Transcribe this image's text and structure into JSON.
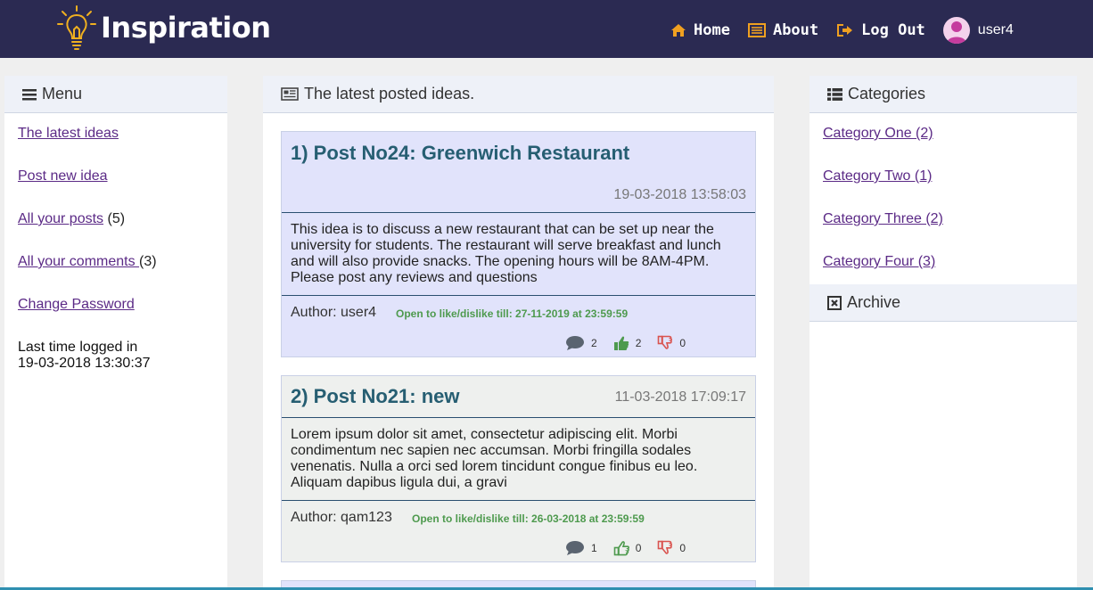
{
  "app": {
    "title": "Inspiration"
  },
  "nav": {
    "home": "Home",
    "about": "About",
    "logout": "Log Out",
    "username": "user4"
  },
  "menu": {
    "title": "Menu",
    "items": [
      {
        "label": "The latest ideas",
        "count": ""
      },
      {
        "label": "Post new idea",
        "count": ""
      },
      {
        "label": "All your posts",
        "count": "(5)"
      },
      {
        "label": "All your comments ",
        "count": "(3)"
      },
      {
        "label": "Change Password",
        "count": ""
      }
    ],
    "last_login_label": "Last time logged in",
    "last_login_value": "19-03-2018 13:30:37"
  },
  "feed": {
    "title": "The latest posted ideas.",
    "posts": [
      {
        "title": "1) Post No24: Greenwich Restaurant",
        "date": "19-03-2018 13:58:03",
        "body": "This idea is to discuss a new restaurant that can be set up near the university for students. The restaurant will serve breakfast and lunch and will also provide snacks. The opening hours will be 8AM-4PM. Please post any reviews and questions",
        "author": "Author: user4",
        "open": "Open to like/dislike till: 27-11-2019 at 23:59:59",
        "comments": "2",
        "likes": "2",
        "dislikes": "0"
      },
      {
        "title": "2) Post No21: new",
        "date": "11-03-2018 17:09:17",
        "body": "Lorem ipsum dolor sit amet, consectetur adipiscing elit. Morbi condimentum nec sapien nec accumsan. Morbi fringilla sodales venenatis. Nulla a orci sed lorem tincidunt congue finibus eu leo. Aliquam dapibus ligula dui, a gravi",
        "author": "Author: qam123",
        "open": "Open to like/dislike till: 26-03-2018 at 23:59:59",
        "comments": "1",
        "likes": "0",
        "dislikes": "0"
      }
    ]
  },
  "categories": {
    "title": "Categories",
    "items": [
      "Category One (2)",
      "Category Two (1)",
      "Category Three (2)",
      "Category Four (3)"
    ],
    "archive_title": "Archive"
  },
  "colors": {
    "header_bg": "#2b2a52",
    "accent_orange": "#f0a020",
    "post_title": "#265e72",
    "link": "#5b2a86",
    "like_green": "#4e9a4e",
    "dislike_red": "#d9534f"
  }
}
